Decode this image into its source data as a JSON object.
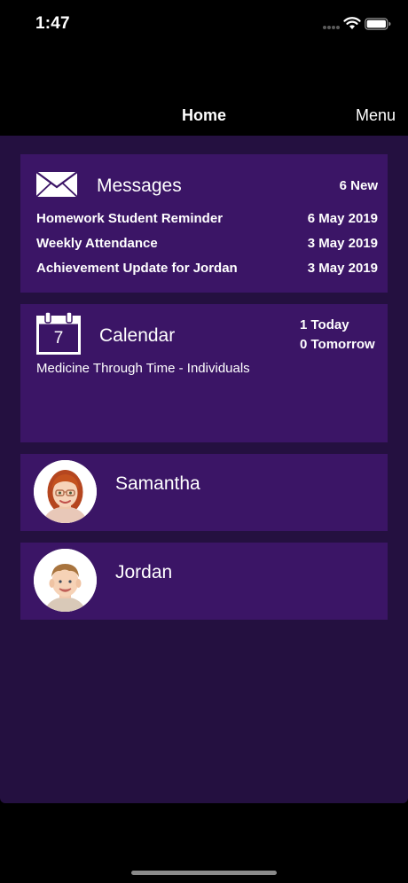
{
  "status_bar": {
    "time": "1:47"
  },
  "nav": {
    "title": "Home",
    "menu_label": "Menu"
  },
  "messages": {
    "title": "Messages",
    "count_label": "6 New",
    "items": [
      {
        "subject": "Homework Student Reminder",
        "date": "6 May 2019"
      },
      {
        "subject": "Weekly Attendance",
        "date": "3 May 2019"
      },
      {
        "subject": "Achievement Update for Jordan",
        "date": "3 May 2019"
      }
    ]
  },
  "calendar": {
    "title": "Calendar",
    "icon_day": "7",
    "today_label": "1 Today",
    "tomorrow_label": "0 Tomorrow",
    "event": "Medicine Through Time - Individuals"
  },
  "children": [
    {
      "name": "Samantha"
    },
    {
      "name": "Jordan"
    }
  ],
  "colors": {
    "background": "#000000",
    "content_bg": "#241040",
    "card_bg": "#3b1566",
    "text": "#ffffff"
  }
}
